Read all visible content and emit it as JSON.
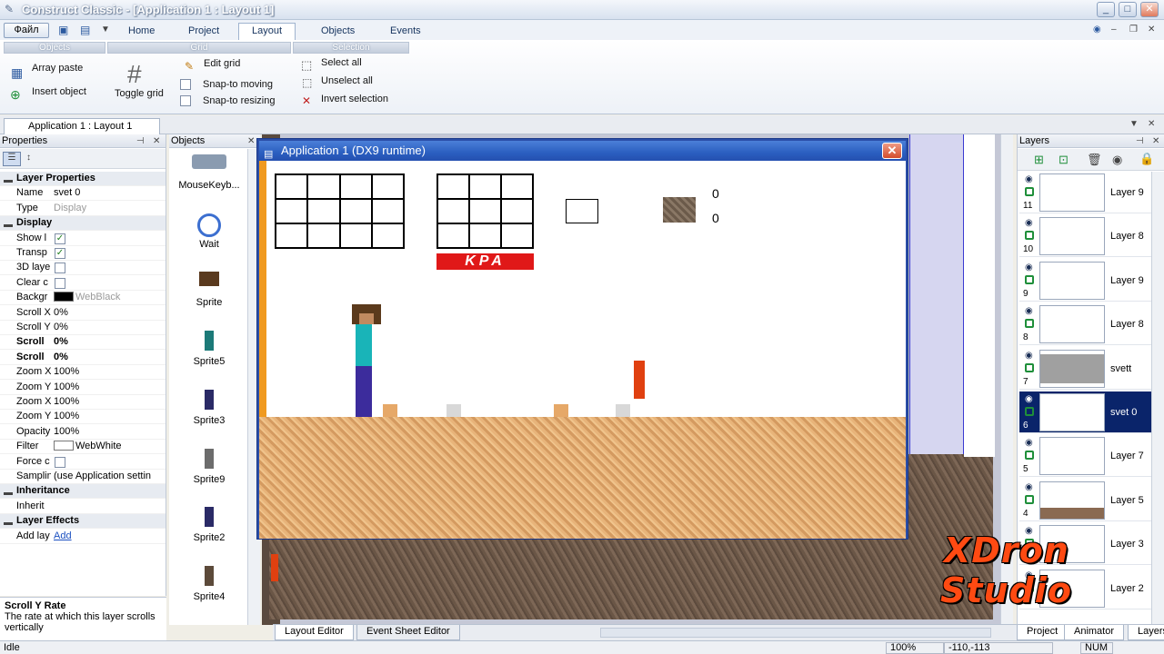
{
  "window": {
    "title": "Construct Classic - [Application 1 : Layout 1]",
    "min": "_",
    "max": "□",
    "close": "✕"
  },
  "ribbon": {
    "file_label": "Файл",
    "tabs": [
      "Home",
      "Project",
      "Layout",
      "Objects",
      "Events"
    ],
    "active_tab": "Layout",
    "groups": {
      "objects": "Objects",
      "grid": "Grid",
      "selection": "Selection"
    },
    "array_paste": "Array paste",
    "insert_object": "Insert object",
    "toggle_grid": "Toggle grid",
    "edit_grid": "Edit grid",
    "snap_moving": "Snap-to moving",
    "snap_resizing": "Snap-to resizing",
    "select_all": "Select all",
    "unselect_all": "Unselect all",
    "invert_selection": "Invert selection"
  },
  "doc_tab": "Application 1 : Layout 1",
  "properties": {
    "header": "Properties",
    "rows": [
      {
        "type": "section",
        "key": "Layer Properties"
      },
      {
        "key": "Name",
        "value": "svet 0"
      },
      {
        "key": "Type",
        "value": "Display",
        "grey": true
      },
      {
        "type": "section",
        "key": "Display"
      },
      {
        "key": "Show l",
        "check": true
      },
      {
        "key": "Transp",
        "check": true
      },
      {
        "key": "3D laye",
        "check": false
      },
      {
        "key": "Clear c",
        "check": false
      },
      {
        "key": "Backgr",
        "value": "WebBlack",
        "grey": true,
        "swatch": "#000000"
      },
      {
        "key": "Scroll X",
        "value": "0%"
      },
      {
        "key": "Scroll Y",
        "value": "0%"
      },
      {
        "key": "Scroll",
        "value": "0%",
        "bold": true
      },
      {
        "key": "Scroll",
        "value": "0%",
        "bold": true
      },
      {
        "key": "Zoom X",
        "value": "100%"
      },
      {
        "key": "Zoom Y",
        "value": "100%"
      },
      {
        "key": "Zoom X",
        "value": "100%"
      },
      {
        "key": "Zoom Y",
        "value": "100%"
      },
      {
        "key": "Opacity",
        "value": "100%"
      },
      {
        "key": "Filter",
        "value": "WebWhite",
        "swatch": "#ffffff"
      },
      {
        "key": "Force c",
        "check": false
      },
      {
        "key": "Samplin",
        "value": "(use Application settin"
      },
      {
        "type": "section",
        "key": "Inheritance"
      },
      {
        "key": "Inherit",
        "value": ""
      },
      {
        "type": "section",
        "key": "Layer Effects"
      },
      {
        "key": "Add lay",
        "value": "Add",
        "link": true
      }
    ],
    "desc_title": "Scroll Y Rate",
    "desc_text": "The rate at which this layer scrolls vertically"
  },
  "objects": {
    "header": "Objects",
    "items": [
      {
        "label": "MouseKeyb...",
        "color": "#8a9bb0"
      },
      {
        "label": "Wait",
        "color": "#3c6fd0"
      },
      {
        "label": "Sprite",
        "color": "#5a3a1e"
      },
      {
        "label": "Sprite5",
        "color": "#1c7a78"
      },
      {
        "label": "Sprite3",
        "color": "#2a2a66"
      },
      {
        "label": "Sprite9",
        "color": "#6c6c6c"
      },
      {
        "label": "Sprite2",
        "color": "#2a2a66"
      },
      {
        "label": "Sprite4",
        "color": "#5c4a3a"
      }
    ]
  },
  "game_window": {
    "title": "Application 1 (DX9 runtime)",
    "counter_1": "0",
    "counter_2": "0",
    "banner_text": "KPA"
  },
  "layers": {
    "header": "Layers",
    "items": [
      {
        "num": "11",
        "name": "Layer 9"
      },
      {
        "num": "10",
        "name": "Layer 8"
      },
      {
        "num": "9",
        "name": "Layer 9"
      },
      {
        "num": "8",
        "name": "Layer 8"
      },
      {
        "num": "7",
        "name": "svett"
      },
      {
        "num": "6",
        "name": "svet 0",
        "selected": true
      },
      {
        "num": "5",
        "name": "Layer 7"
      },
      {
        "num": "4",
        "name": "Layer 5"
      },
      {
        "num": "3",
        "name": "Layer 3"
      },
      {
        "num": "2",
        "name": "Layer 2"
      }
    ]
  },
  "bottom_tabs": [
    "Layout Editor",
    "Event Sheet Editor"
  ],
  "right_tabs": [
    "Project",
    "Animator",
    "Layers"
  ],
  "status": {
    "state": "Idle",
    "zoom": "100%",
    "coords": "-110,-113",
    "num": "NUM"
  },
  "watermark": {
    "line1": "XDron",
    "line2": "Studio"
  }
}
